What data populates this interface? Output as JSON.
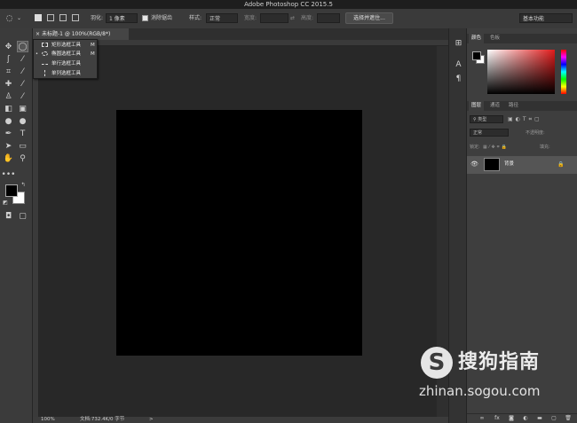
{
  "app": {
    "title": "Adobe Photoshop CC 2015.5"
  },
  "options_bar": {
    "feather_label": "羽化:",
    "feather_value": "1 像素",
    "antialias_label": "消除锯齿",
    "style_label": "样式:",
    "style_value": "正常",
    "width_label": "宽度:",
    "height_label": "高度:",
    "select_mask_button": "选择并遮住...",
    "workspace_value": "基本功能"
  },
  "document": {
    "tab_title": "未标题-1 @ 100%(RGB/8*)"
  },
  "tool_flyout": {
    "items": [
      {
        "label": "矩形选框工具",
        "key": "M"
      },
      {
        "label": "椭圆选框工具",
        "key": "M"
      },
      {
        "label": "单行选框工具",
        "key": ""
      },
      {
        "label": "单列选框工具",
        "key": ""
      }
    ]
  },
  "status_bar": {
    "zoom": "100%",
    "doc_info": "文档:732.4K/0 字节",
    "arrow": ">"
  },
  "color_panel": {
    "tabs": [
      "颜色",
      "色板"
    ]
  },
  "layers_panel": {
    "tabs": [
      "图层",
      "通道",
      "路径"
    ],
    "filter_kind": "类型",
    "blend_mode": "正常",
    "opacity_label": "不透明度:",
    "lock_label": "锁定:",
    "fill_label": "填充:",
    "layers": [
      {
        "name": "背景"
      }
    ]
  },
  "watermark": {
    "brand": "搜狗指南",
    "url": "zhinan.sogou.com",
    "logo_letter": "S"
  },
  "colors": {
    "canvas": "#000000",
    "workspace": "#282828",
    "panel": "#3e3e3e"
  }
}
